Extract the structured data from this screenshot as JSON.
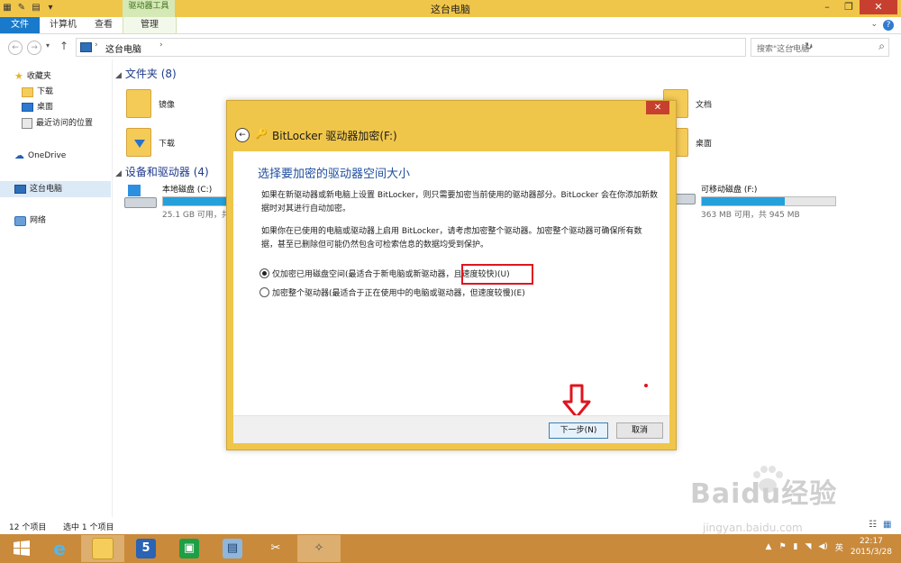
{
  "window": {
    "title": "这台电脑",
    "tool_tab": "驱动器工具"
  },
  "ribbon": {
    "tabs": [
      "文件",
      "计算机",
      "查看",
      "管理"
    ]
  },
  "address": {
    "path": "这台电脑",
    "search_placeholder": "搜索\"这台电脑\""
  },
  "nav": {
    "favorites": "收藏夹",
    "downloads": "下载",
    "desktop": "桌面",
    "recent": "最近访问的位置",
    "onedrive": "OneDrive",
    "thispc": "这台电脑",
    "network": "网络"
  },
  "content": {
    "folders_header": "文件夹 (8)",
    "devices_header": "设备和驱动器 (4)",
    "folders": {
      "mirror": "镜像",
      "docs": "文档",
      "downloads": "下载",
      "desktop": "桌面"
    },
    "drives": [
      {
        "name": "本地磁盘 (C:)",
        "info": "25.1 GB 可用，共",
        "used_fraction": 0.55
      },
      {
        "name": "可移动磁盘 (F:)",
        "info": "363 MB 可用，共 945 MB",
        "used_fraction": 0.62
      }
    ]
  },
  "status": {
    "items": "12 个项目",
    "selected": "选中 1 个项目"
  },
  "dialog": {
    "title": "BitLocker 驱动器加密(F:)",
    "heading": "选择要加密的驱动器空间大小",
    "para1": "如果在新驱动器或新电脑上设置 BitLocker，则只需要加密当前使用的驱动器部分。BitLocker 会在你添加新数据时对其进行自动加密。",
    "para2": "如果你在已使用的电脑或驱动器上启用 BitLocker，请考虑加密整个驱动器。加密整个驱动器可确保所有数据，甚至已删除但可能仍然包含可检索信息的数据均受到保护。",
    "option1": "仅加密已用磁盘空间(最适合于新电脑或新驱动器，且速度较快)(U)",
    "option2": "加密整个驱动器(最适合于正在使用中的电脑或驱动器，但速度较慢)(E)",
    "next": "下一步(N)",
    "cancel": "取消"
  },
  "taskbar": {
    "time": "22:17",
    "date": "2015/3/28",
    "ime": "英"
  },
  "watermark": {
    "brand": "Baidu经验",
    "url": "jingyan.baidu.com"
  }
}
